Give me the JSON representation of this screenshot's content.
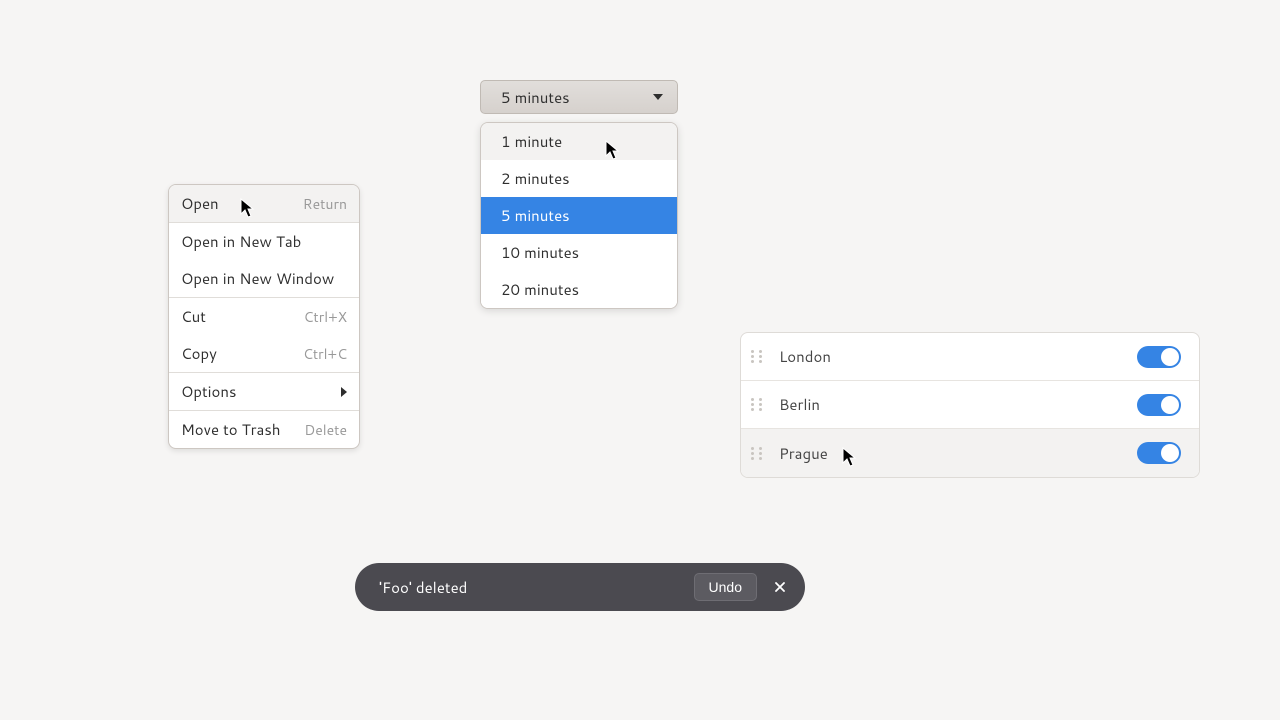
{
  "context_menu": {
    "items": [
      {
        "label": "Open",
        "accel": "Return",
        "hovered": true
      },
      {
        "label": "Open in New Tab"
      },
      {
        "label": "Open in New Window"
      }
    ],
    "items2": [
      {
        "label": "Cut",
        "accel": "Ctrl+X"
      },
      {
        "label": "Copy",
        "accel": "Ctrl+C"
      }
    ],
    "items3": [
      {
        "label": "Options",
        "submenu": true
      }
    ],
    "items4": [
      {
        "label": "Move to Trash",
        "accel": "Delete"
      }
    ]
  },
  "dropdown": {
    "selected": "5 minutes",
    "options": [
      "1 minute",
      "2 minutes",
      "5 minutes",
      "10 minutes",
      "20 minutes"
    ],
    "hovered_index": 0,
    "selected_index": 2
  },
  "list": {
    "rows": [
      {
        "label": "London",
        "on": true
      },
      {
        "label": "Berlin",
        "on": true
      },
      {
        "label": "Prague",
        "on": true,
        "hovered": true
      }
    ]
  },
  "toast": {
    "message": "'Foo' deleted",
    "undo_label": "Undo"
  }
}
